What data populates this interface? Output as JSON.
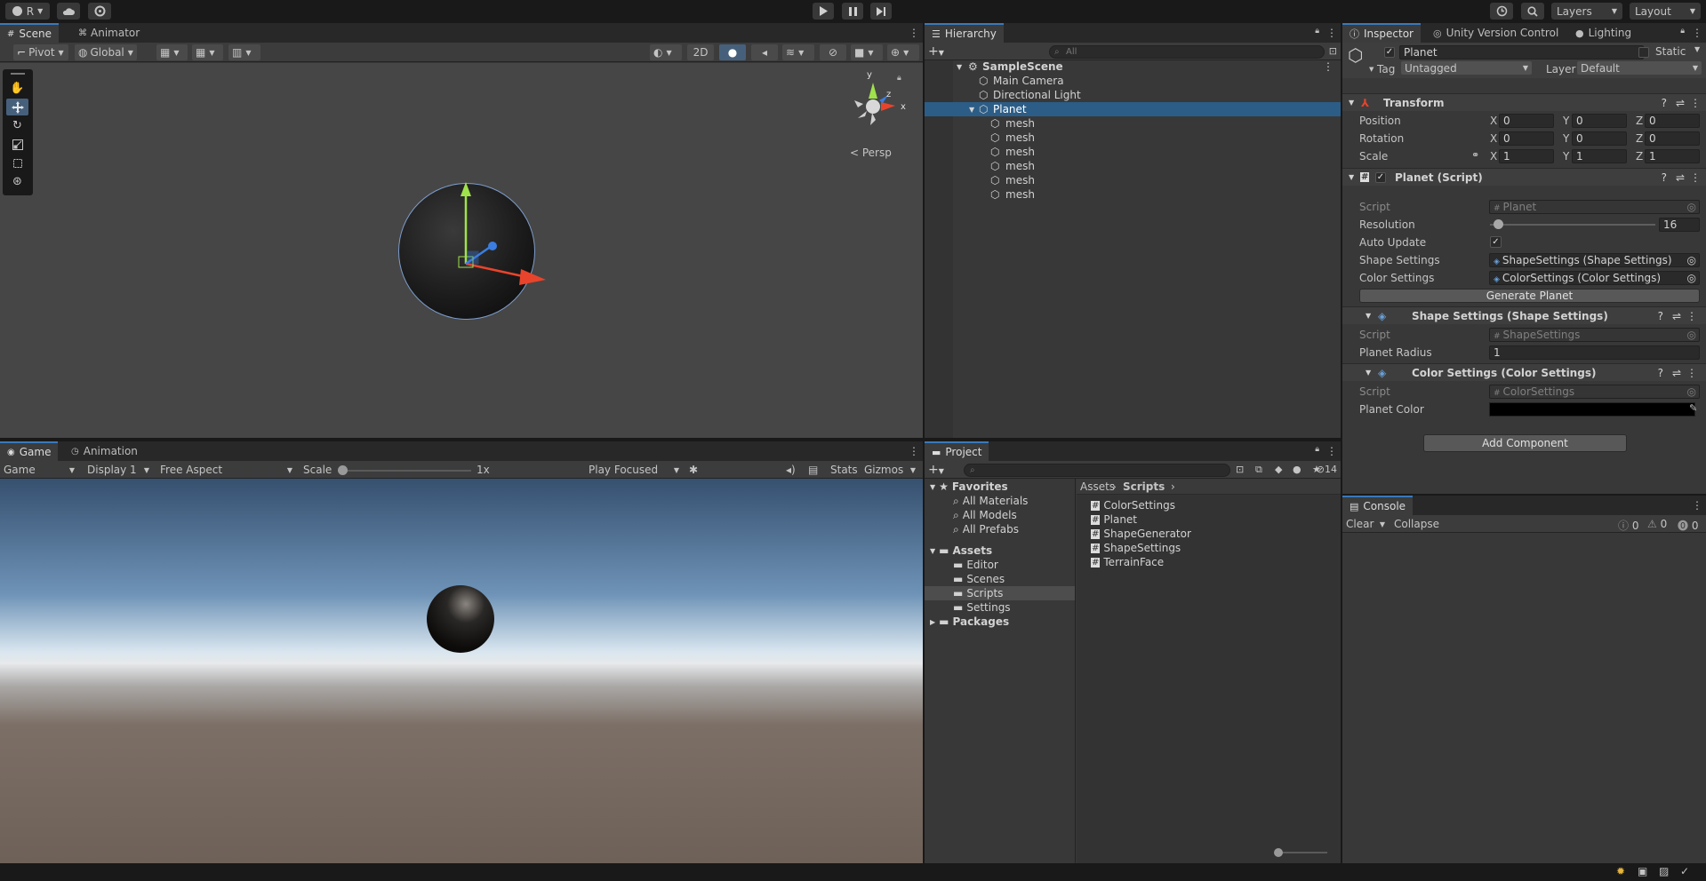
{
  "toolbar": {
    "account": "R",
    "layers": "Layers",
    "layout": "Layout"
  },
  "scene": {
    "tabs": [
      "Scene",
      "Animator"
    ],
    "pivot": "Pivot",
    "global": "Global",
    "mode_2d": "2D",
    "persp": "< Persp",
    "gizmo_axes": {
      "y": "y",
      "z": "z",
      "x": "x"
    }
  },
  "game": {
    "tabs": [
      "Game",
      "Animation"
    ],
    "display_mode": "Game",
    "display": "Display 1",
    "aspect": "Free Aspect",
    "scale_label": "Scale",
    "scale_value": "1x",
    "scale_level": 0,
    "play_mode": "Play Focused",
    "stats": "Stats",
    "gizmos": "Gizmos"
  },
  "hierarchy": {
    "title": "Hierarchy",
    "search_placeholder": "All",
    "scene": "SampleScene",
    "items": [
      "Main Camera",
      "Directional Light",
      "Planet"
    ],
    "children": [
      "mesh",
      "mesh",
      "mesh",
      "mesh",
      "mesh",
      "mesh"
    ]
  },
  "project": {
    "title": "Project",
    "hidden_count": "14",
    "favorites": "Favorites",
    "favorite_items": [
      "All Materials",
      "All Models",
      "All Prefabs"
    ],
    "assets": "Assets",
    "asset_folders": [
      "Editor",
      "Scenes",
      "Scripts",
      "Settings"
    ],
    "packages": "Packages",
    "breadcrumb": [
      "Assets",
      "Scripts"
    ],
    "files": [
      "ColorSettings",
      "Planet",
      "ShapeGenerator",
      "ShapeSettings",
      "TerrainFace"
    ]
  },
  "inspector": {
    "tabs": [
      "Inspector",
      "Unity Version Control",
      "Lighting"
    ],
    "object_name": "Planet",
    "static_label": "Static",
    "tag_label": "Tag",
    "tag_value": "Untagged",
    "layer_label": "Layer",
    "layer_value": "Default",
    "transform": {
      "title": "Transform",
      "position_label": "Position",
      "rotation_label": "Rotation",
      "scale_label": "Scale",
      "axis_x": "X",
      "axis_y": "Y",
      "axis_z": "Z",
      "position": [
        "0",
        "0",
        "0"
      ],
      "rotation": [
        "0",
        "0",
        "0"
      ],
      "scale": [
        "1",
        "1",
        "1"
      ]
    },
    "planet_script": {
      "title": "Planet (Script)",
      "script_label": "Script",
      "script_value": "Planet",
      "resolution_label": "Resolution",
      "resolution_value": "16",
      "resolution_level": 0.05,
      "auto_update_label": "Auto Update",
      "shape_label": "Shape Settings",
      "shape_value": "ShapeSettings (Shape Settings)",
      "color_label": "Color Settings",
      "color_value": "ColorSettings (Color Settings)",
      "generate_button": "Generate Planet"
    },
    "shape_settings": {
      "title": "Shape Settings (Shape Settings)",
      "script_label": "Script",
      "script_value": "ShapeSettings",
      "radius_label": "Planet Radius",
      "radius_value": "1"
    },
    "color_settings": {
      "title": "Color Settings (Color Settings)",
      "script_label": "Script",
      "script_value": "ColorSettings",
      "color_label": "Planet Color",
      "color_value": "#000000"
    },
    "add_component": "Add Component"
  },
  "console": {
    "title": "Console",
    "clear": "Clear",
    "collapse": "Collapse",
    "counts": [
      "0",
      "0",
      "0"
    ]
  },
  "colors": {
    "accent": "#3a79bb",
    "selection": "#2c5d87"
  }
}
